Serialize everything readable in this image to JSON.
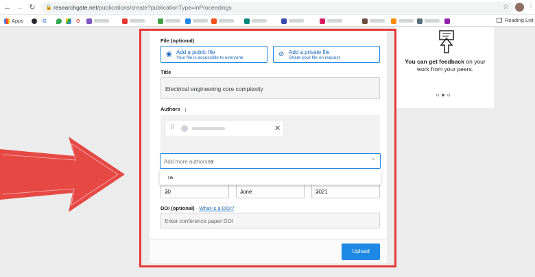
{
  "browser": {
    "url_host": "researchgate.net",
    "url_path": "/publications/create?publicationType=inProceedings",
    "bookmarks": [
      "Apps",
      "G",
      "G"
    ],
    "reading_list": "Reading List"
  },
  "form": {
    "file_label": "File (optional)",
    "public_file": {
      "title": "Add a public file",
      "subtitle": "Your file is accessible to everyone"
    },
    "private_file": {
      "title": "Add a private file",
      "subtitle": "Share your file on request"
    },
    "title_label": "Title",
    "title_value": "Electrical engineering core complexity",
    "authors_label": "Authors",
    "authors_info": "i",
    "author_input_placeholder": "Add more authors: ",
    "author_input_value": "ra",
    "dropdown_option": "ra",
    "date": {
      "day": "20",
      "month": "June",
      "year": "2021"
    },
    "doi_label": "DOI (optional)",
    "doi_sep": " · ",
    "doi_link": "What is a DOI?",
    "doi_placeholder": "Enter conference paper DOI",
    "upload_label": "Upload"
  },
  "side_card": {
    "bold": "You can get feedback",
    "rest": " on your work from your peers."
  },
  "colors": {
    "accent": "#1e88e5",
    "highlight_border": "#e53935"
  }
}
